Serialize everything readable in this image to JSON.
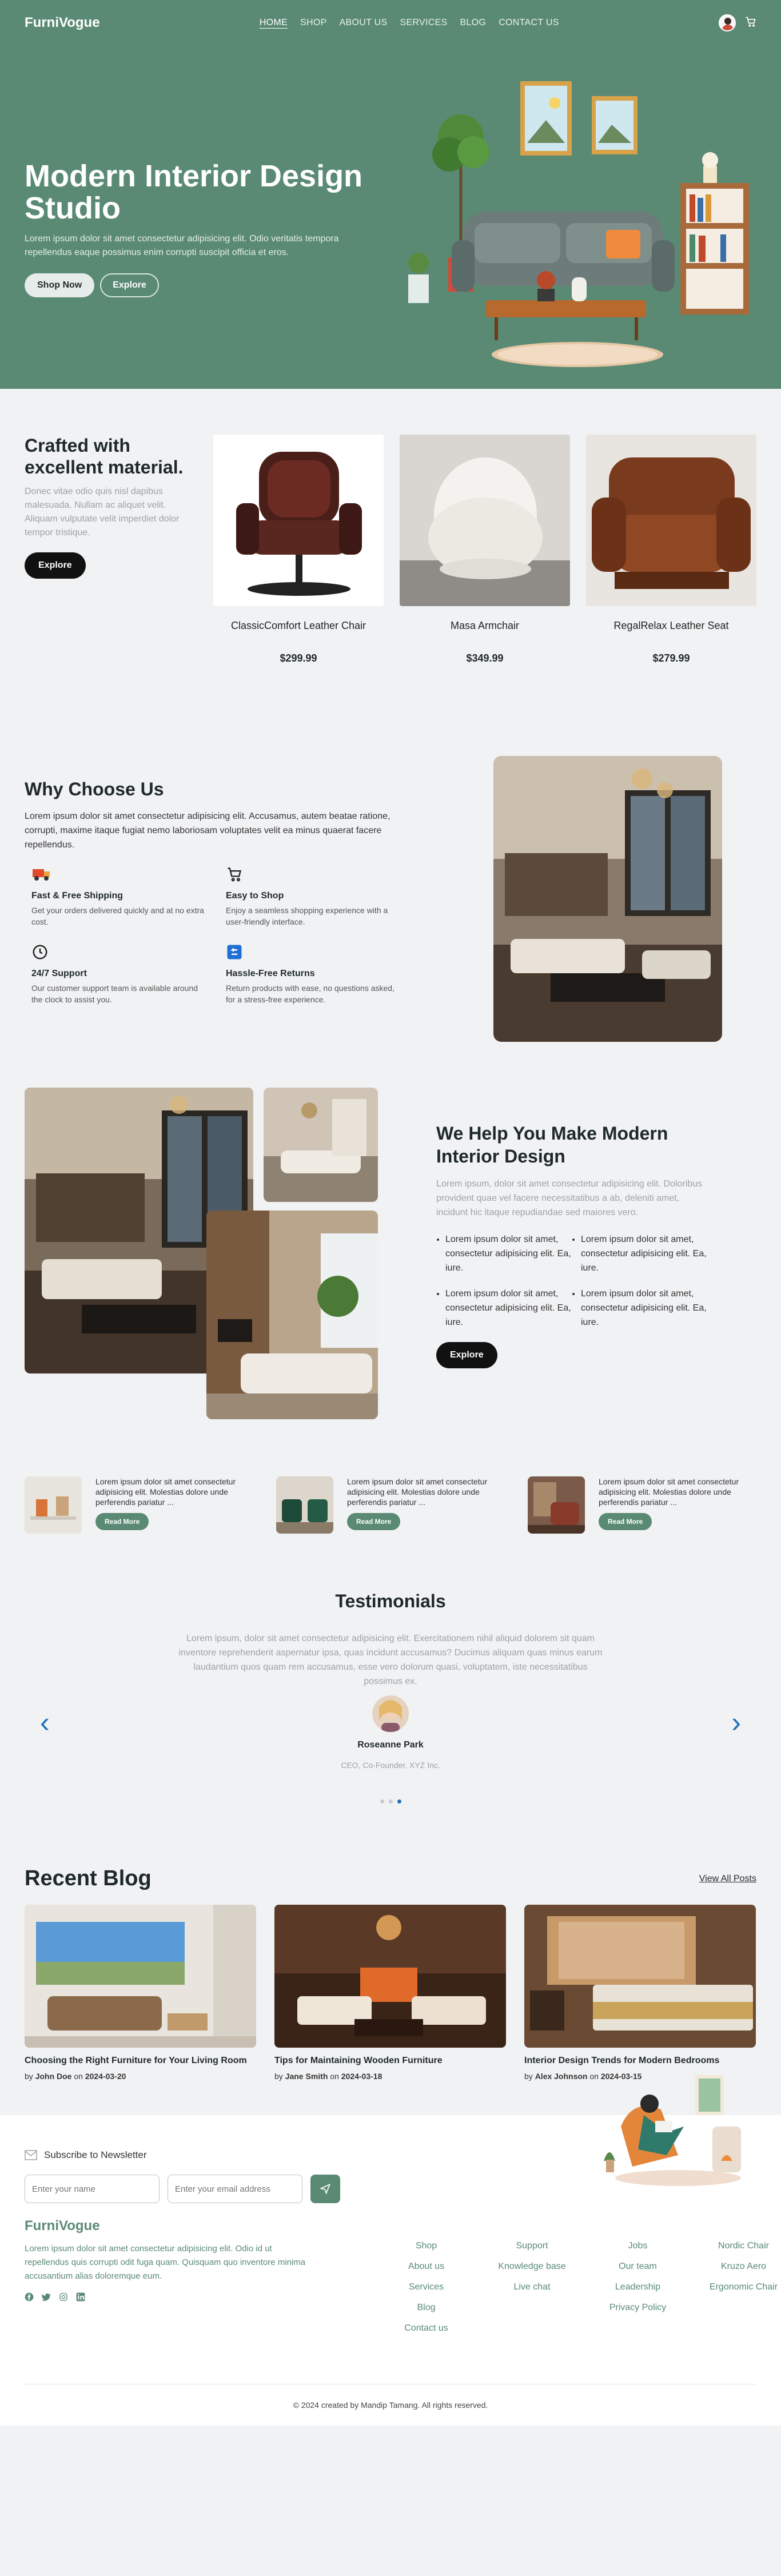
{
  "nav": {
    "logo": "FurniVogue",
    "links": [
      "HOME",
      "SHOP",
      "ABOUT US",
      "SERVICES",
      "BLOG",
      "CONTACT US"
    ],
    "cart_icon": "cart-icon"
  },
  "hero": {
    "title": "Modern Interior Design Studio",
    "subtitle": "Lorem ipsum dolor sit amet consectetur adipisicing elit. Odio veritatis tempora repellendus eaque possimus enim corrupti suscipit officia et eros.",
    "primary_btn": "Shop Now",
    "secondary_btn": "Explore"
  },
  "crafted": {
    "title": "Crafted with excellent material.",
    "text": "Donec vitae odio quis nisl dapibus malesuada. Nullam ac aliquet velit. Aliquam vulputate velit imperdiet dolor tempor tristique.",
    "button": "Explore",
    "products": [
      {
        "name": "ClassicComfort Leather Chair",
        "price": "$299.99"
      },
      {
        "name": "Masa Armchair",
        "price": "$349.99"
      },
      {
        "name": "RegalRelax Leather Seat",
        "price": "$279.99"
      }
    ]
  },
  "why": {
    "title": "Why Choose Us",
    "lead": "Lorem ipsum dolor sit amet consectetur adipisicing elit. Accusamus, autem beatae ratione, corrupti, maxime itaque fugiat nemo laboriosam voluptates velit ea minus quaerat facere repellendus.",
    "features": [
      {
        "title": "Fast & Free Shipping",
        "text": "Get your orders delivered quickly and at no extra cost.",
        "icon": "truck-icon"
      },
      {
        "title": "Easy to Shop",
        "text": "Enjoy a seamless shopping experience with a user-friendly interface.",
        "icon": "cart-icon"
      },
      {
        "title": "24/7 Support",
        "text": "Our customer support team is available around the clock to assist you.",
        "icon": "clock-icon"
      },
      {
        "title": "Hassle-Free Returns",
        "text": "Return products with ease, no questions asked, for a stress-free experience.",
        "icon": "return-icon"
      }
    ]
  },
  "help": {
    "title": "We Help You Make Modern Interior Design",
    "lead": "Lorem ipsum, dolor sit amet consectetur adipisicing elit. Doloribus provident quae vel facere necessitatibus a ab, deleniti amet, incidunt hic itaque repudiandae sed maiores vero.",
    "bullets": [
      "Lorem ipsum dolor sit amet, consectetur adipisicing elit. Ea, iure.",
      "Lorem ipsum dolor sit amet, consectetur adipisicing elit. Ea, iure.",
      "Lorem ipsum dolor sit amet, consectetur adipisicing elit. Ea, iure.",
      "Lorem ipsum dolor sit amet, consectetur adipisicing elit. Ea, iure."
    ],
    "button": "Explore"
  },
  "mini_posts": [
    {
      "text": "Lorem ipsum dolor sit amet consectetur adipisicing elit. Molestias dolore unde perferendis pariatur ...",
      "button": "Read More"
    },
    {
      "text": "Lorem ipsum dolor sit amet consectetur adipisicing elit. Molestias dolore unde perferendis pariatur ...",
      "button": "Read More"
    },
    {
      "text": "Lorem ipsum dolor sit amet consectetur adipisicing elit. Molestias dolore unde perferendis pariatur ...",
      "button": "Read More"
    }
  ],
  "testimonials": {
    "title": "Testimonials",
    "quote": "Lorem ipsum, dolor sit amet consectetur adipisicing elit. Exercitationem nihil aliquid dolorem sit quam inventore reprehenderit aspernatur ipsa, quas incidunt accusamus? Ducimus aliquam quas minus earum laudantium quos quam rem accusamus, esse vero dolorum quasi, voluptatem, iste necessitatibus possimus ex.",
    "name": "Roseanne Park",
    "role": "CEO, Co-Founder, XYZ Inc.",
    "active_dot": 3
  },
  "blog": {
    "title": "Recent Blog",
    "view_all": "View All Posts",
    "posts": [
      {
        "title": "Choosing the Right Furniture for Your Living Room",
        "by": "by",
        "author": "John Doe",
        "on": "on",
        "date": "2024-03-20"
      },
      {
        "title": "Tips for Maintaining Wooden Furniture",
        "by": "by",
        "author": "Jane Smith",
        "on": "on",
        "date": "2024-03-18"
      },
      {
        "title": "Interior Design Trends for Modern Bedrooms",
        "by": "by",
        "author": "Alex Johnson",
        "on": "on",
        "date": "2024-03-15"
      }
    ]
  },
  "footer": {
    "newsletter_label": "Subscribe to Newsletter",
    "name_placeholder": "Enter your name",
    "email_placeholder": "Enter your email address",
    "brand": "FurniVogue",
    "brand_text": "Lorem ipsum dolor sit amet consectetur adipisicing elit. Odio id ut repellendus quis corrupti odit fuga quam. Quisquam quo inventore minima accusantium alias doloremque eum.",
    "columns": [
      [
        "Shop",
        "About us",
        "Services",
        "Blog",
        "Contact us"
      ],
      [
        "Support",
        "Knowledge base",
        "Live chat"
      ],
      [
        "Jobs",
        "Our team",
        "Leadership",
        "Privacy Policy"
      ],
      [
        "Nordic Chair",
        "Kruzo Aero",
        "Ergonomic Chair"
      ]
    ],
    "copyright": "© 2024 created by Mandip Tamang. All rights reserved."
  },
  "colors": {
    "brand_green": "#5a8a74",
    "accent_blue": "#1f6fb8"
  }
}
